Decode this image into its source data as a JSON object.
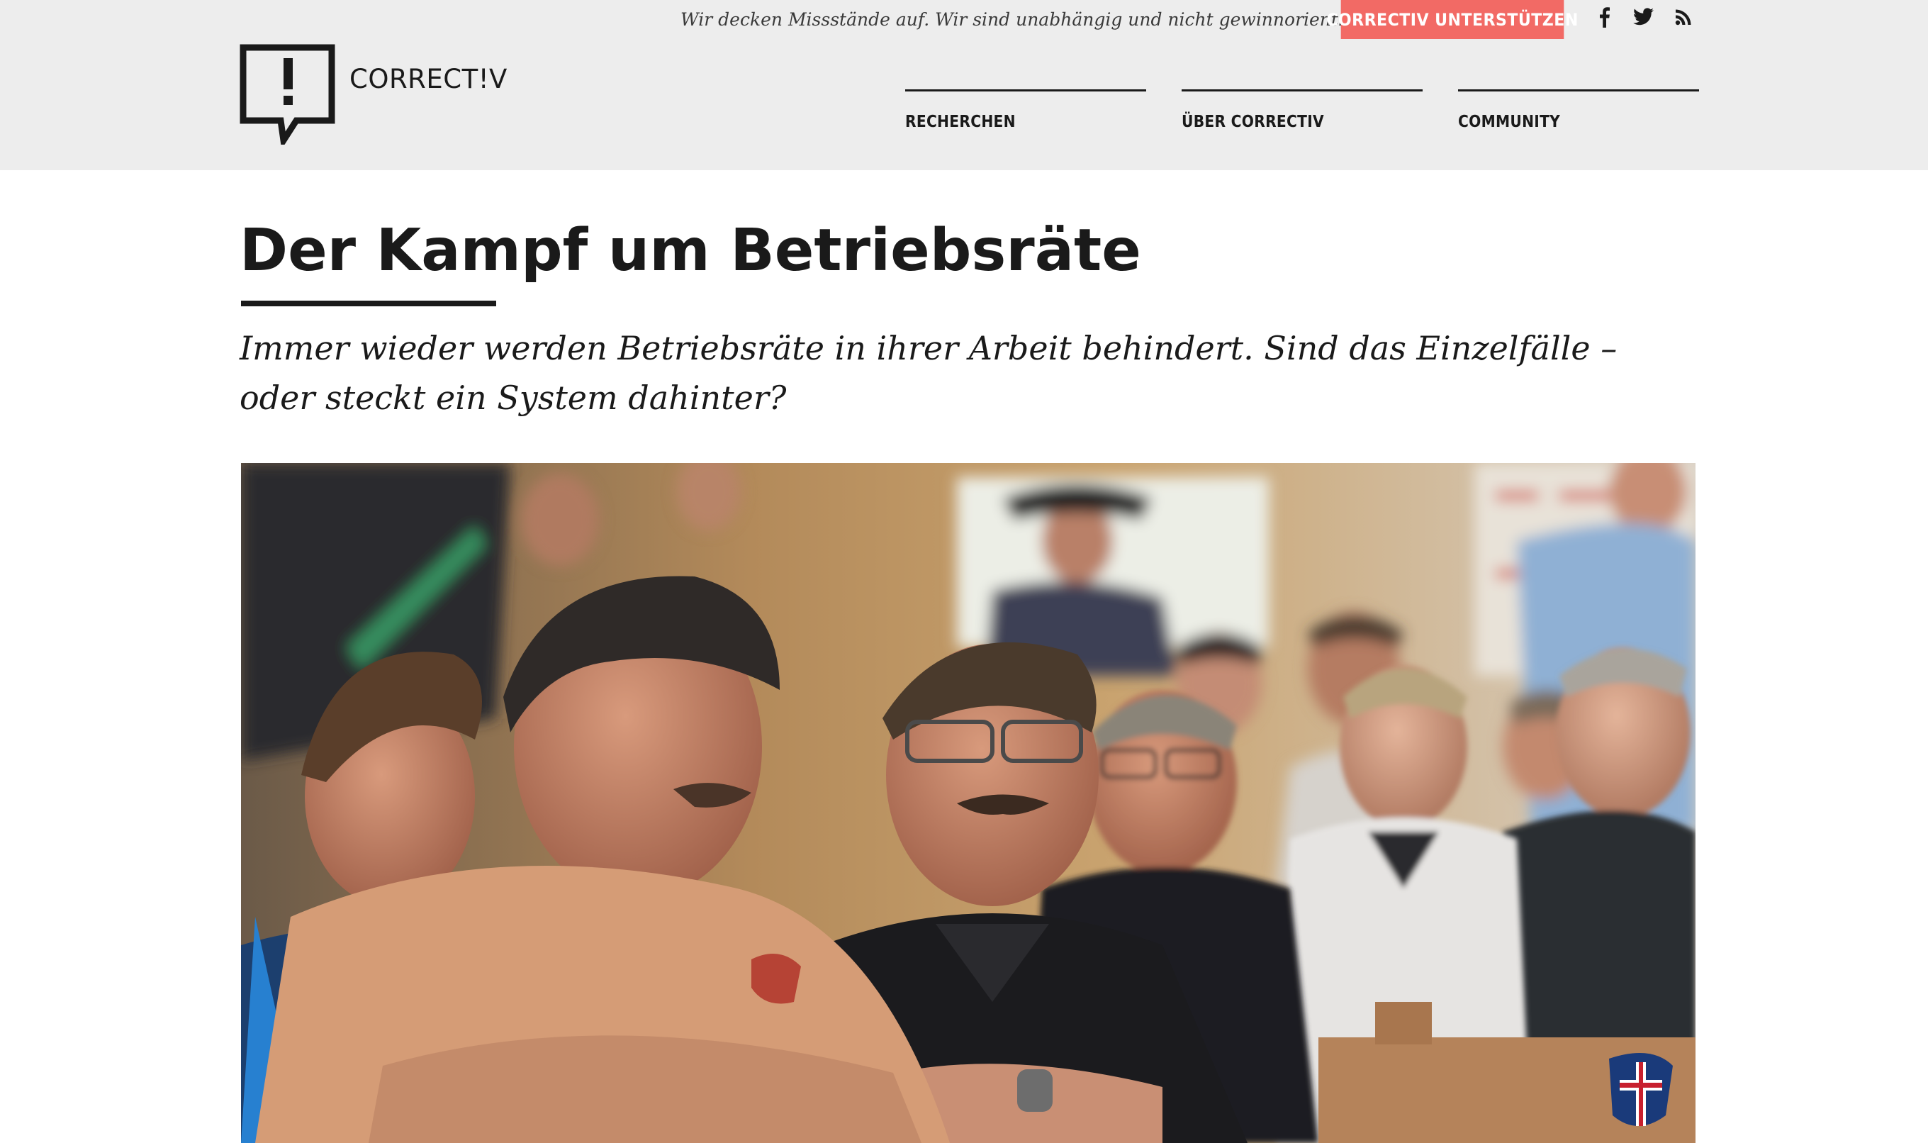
{
  "topbar": {
    "tagline": "Wir decken Missstände auf. Wir sind unabhängig und nicht gewinnorientiert.",
    "support_label": "CORRECTIV UNTERSTÜTZEN",
    "support_color": "#f26a65",
    "social_icons": [
      "facebook-icon",
      "twitter-icon",
      "rss-icon"
    ]
  },
  "logo": {
    "text": "CORRECT!V",
    "icon": "speech-bubble-exclamation-icon"
  },
  "nav": {
    "items": [
      {
        "label": "RECHERCHEN"
      },
      {
        "label": "ÜBER CORRECTIV"
      },
      {
        "label": "COMMUNITY"
      }
    ]
  },
  "article": {
    "title": "Der Kampf um Betriebsräte",
    "subtitle": "Immer wieder werden Betriebsräte in ihrer Arbeit behindert. Sind das Einzelfälle – oder steckt ein System dahinter?",
    "hero_image": "photo of men sitting in an audience at a meeting"
  },
  "colors": {
    "header_bg": "#ededed",
    "text": "#1a1a1a",
    "accent": "#f26a65"
  }
}
